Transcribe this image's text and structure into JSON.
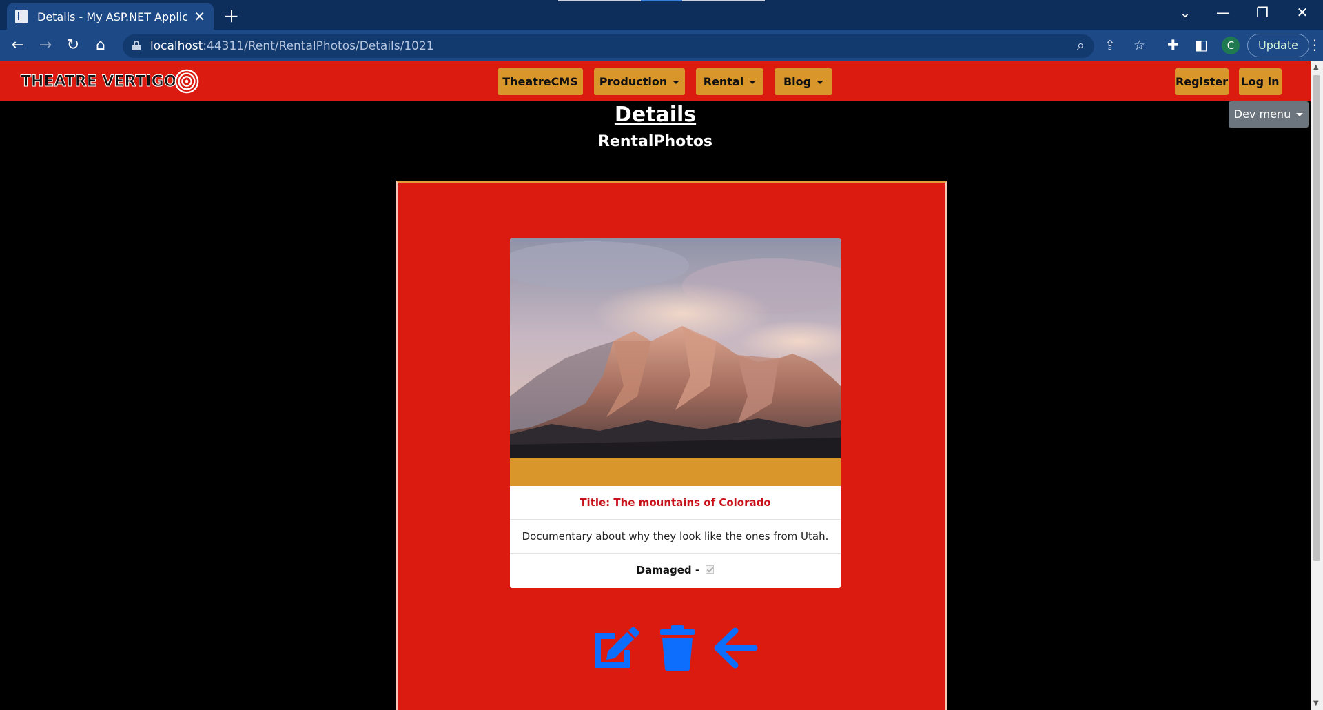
{
  "browser": {
    "tab_title": "Details - My ASP.NET Application",
    "url_host": "localhost",
    "url_rest": ":44311/Rent/RentalPhotos/Details/1021",
    "update_label": "Update",
    "profile_initial": "C"
  },
  "site": {
    "logo_text": "THEATRE VERTIGO",
    "nav": [
      {
        "label": "TheatreCMS",
        "dropdown": false
      },
      {
        "label": "Production",
        "dropdown": true
      },
      {
        "label": "Rental",
        "dropdown": true
      },
      {
        "label": "Blog",
        "dropdown": true
      }
    ],
    "register_label": "Register",
    "login_label": "Log in",
    "dev_menu_label": "Dev menu"
  },
  "main": {
    "heading": "Details",
    "subheading": "RentalPhotos",
    "card": {
      "title": "Title: The mountains of Colorado",
      "description": "Documentary about why they look like the ones from Utah.",
      "damaged_label": "Damaged -",
      "damaged_checked": true
    },
    "actions": [
      "edit-icon",
      "trash-icon",
      "arrow-left-icon"
    ],
    "colors": {
      "nav_red": "#db1a10",
      "button_gold": "#d9962b",
      "action_blue": "#0d6efd"
    }
  }
}
